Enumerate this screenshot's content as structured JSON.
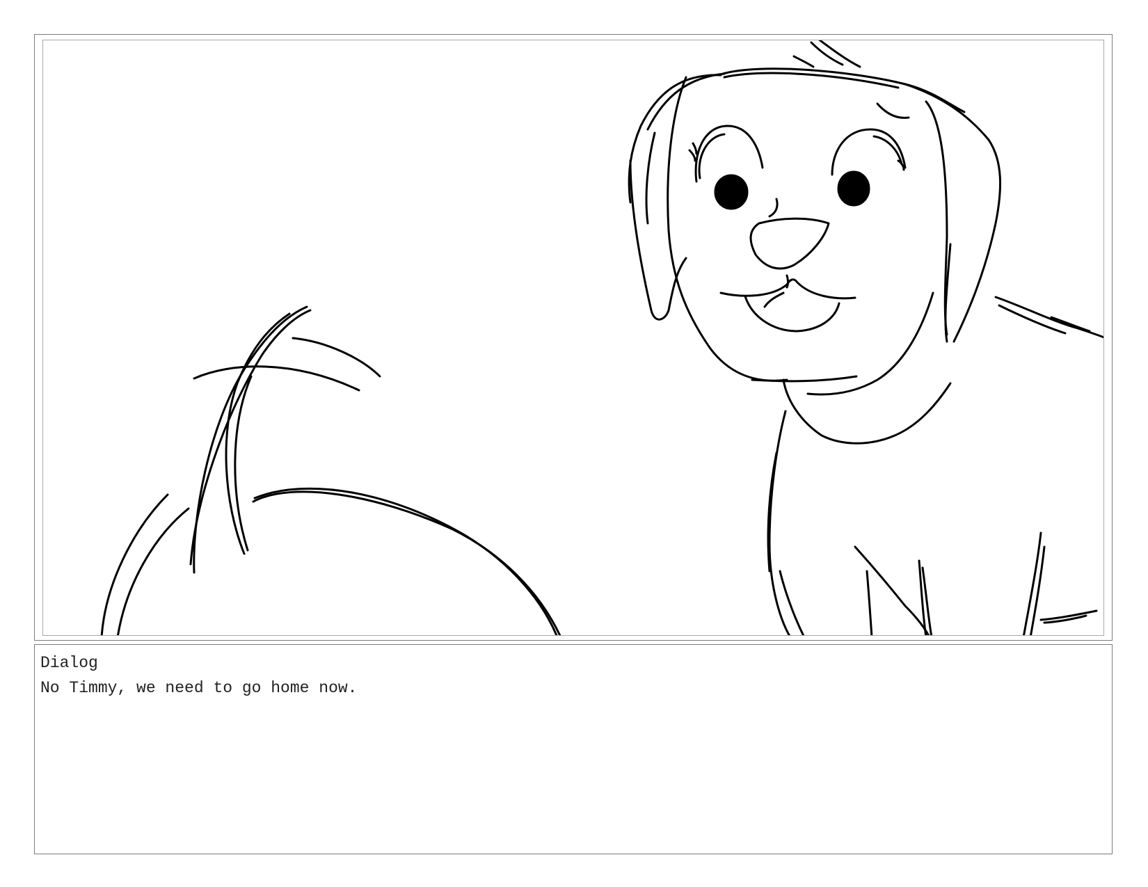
{
  "dialog": {
    "heading": "Dialog",
    "text": "No Timmy, we need to go home now."
  },
  "colors": {
    "frame_border": "#7a7a7a",
    "inner_border": "#a8a8a8",
    "ink": "#000000",
    "text": "#222222",
    "background": "#ffffff"
  }
}
